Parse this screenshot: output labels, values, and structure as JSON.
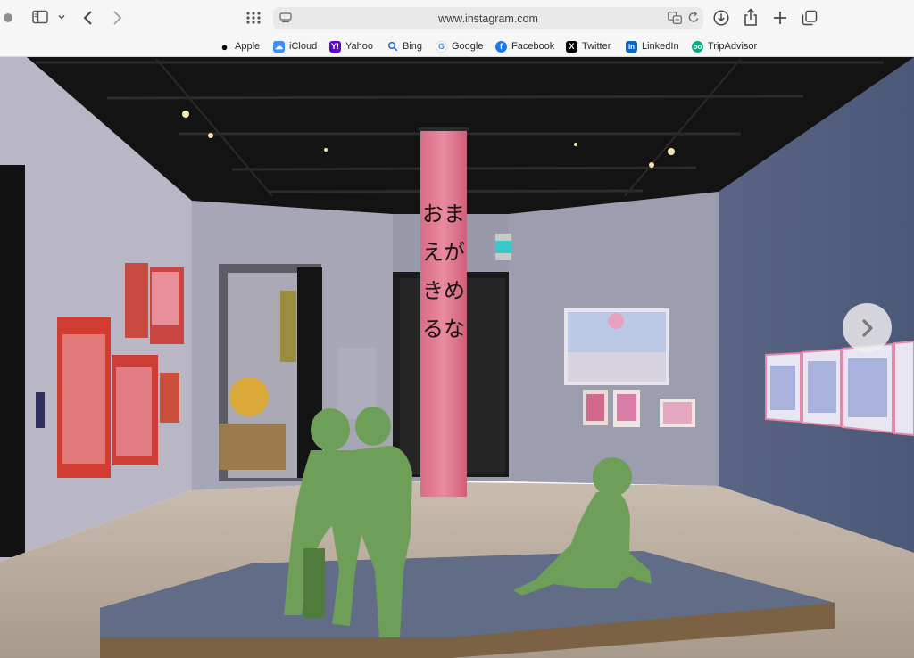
{
  "browser": {
    "url": "www.instagram.com",
    "icons": {
      "window_dot": "window-dot",
      "sidebar": "sidebar-icon",
      "sidebar_menu": "chevron-down-icon",
      "back": "chevron-left-icon",
      "forward": "chevron-right-icon",
      "tab_overview": "grid-icon",
      "page_menu": "page-menu-icon",
      "translate": "translate-icon",
      "reload": "reload-icon",
      "downloads": "download-icon",
      "share": "share-icon",
      "new_tab": "plus-icon",
      "tabs": "tabs-icon"
    }
  },
  "favorites": [
    {
      "label": "Apple",
      "icon": "apple-icon",
      "color": "#000000"
    },
    {
      "label": "iCloud",
      "icon": "icloud-icon",
      "color": "#3b8ff0"
    },
    {
      "label": "Yahoo",
      "icon": "yahoo-icon",
      "color": "#6001d2"
    },
    {
      "label": "Bing",
      "icon": "search-icon",
      "color": "#2b6fd6"
    },
    {
      "label": "Google",
      "icon": "google-icon",
      "color": "#4285f4"
    },
    {
      "label": "Facebook",
      "icon": "facebook-icon",
      "color": "#1877f2"
    },
    {
      "label": "Twitter",
      "icon": "x-icon",
      "color": "#000000"
    },
    {
      "label": "LinkedIn",
      "icon": "linkedin-icon",
      "color": "#0a66c2"
    },
    {
      "label": "TripAdvisor",
      "icon": "tripadvisor-icon",
      "color": "#00af87"
    }
  ],
  "post": {
    "banner_text": "おまえがきめるな",
    "next_icon": "chevron-right-icon"
  }
}
